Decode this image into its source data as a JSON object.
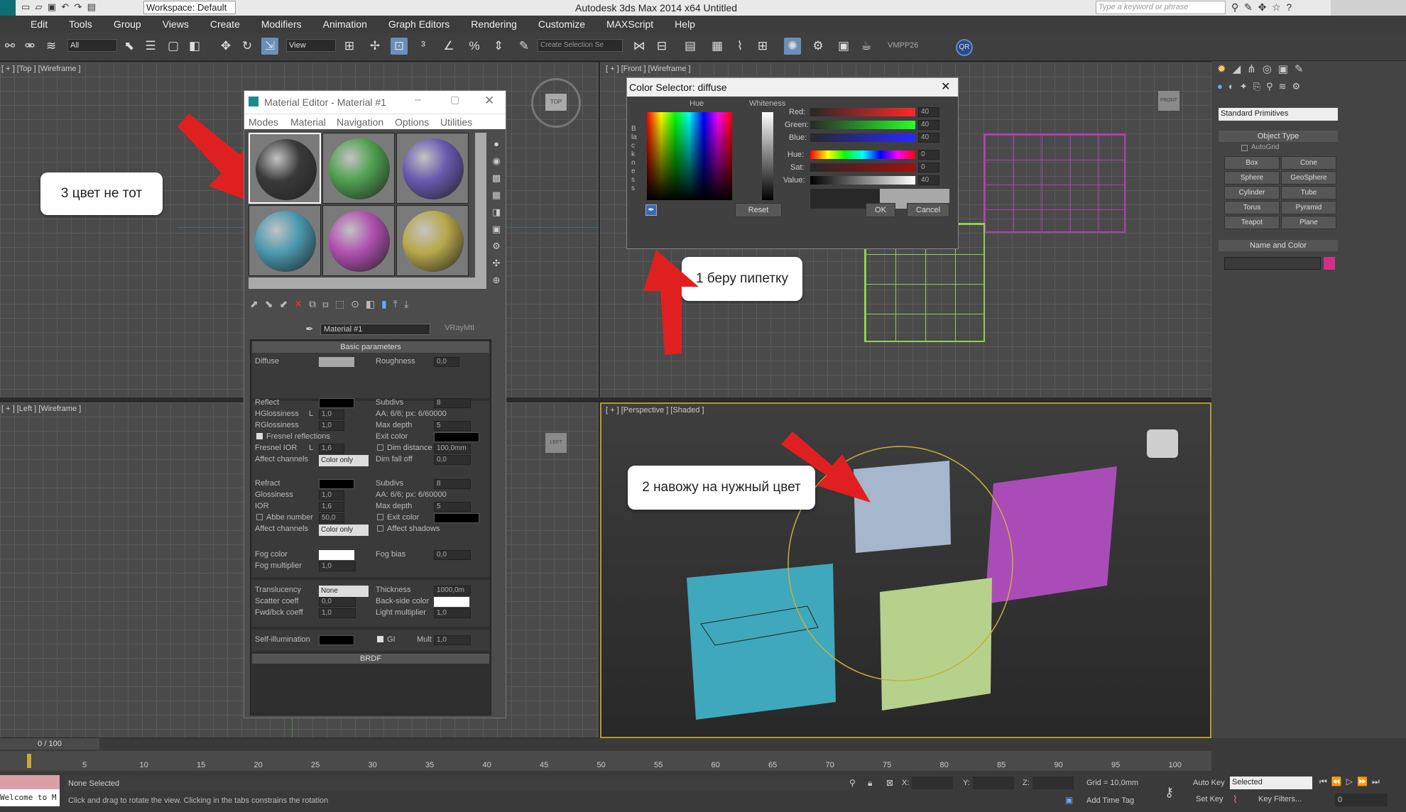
{
  "window": {
    "title": "Autodesk 3ds Max  2014 x64      Untitled",
    "workspace": "Workspace: Default",
    "search_placeholder": "Type a keyword or phrase"
  },
  "menu": [
    "Edit",
    "Tools",
    "Group",
    "Views",
    "Create",
    "Modifiers",
    "Animation",
    "Graph Editors",
    "Rendering",
    "Customize",
    "MAXScript",
    "Help"
  ],
  "toolbar": {
    "selection_filter": "All",
    "view": "View",
    "create_selection": "Create Selection Se",
    "vmpp": "VMPP26",
    "qr": "QR"
  },
  "viewports": {
    "top": "[ + ] [Top ] [Wireframe ]",
    "front": "[ + ] [Front ] [Wireframe ]",
    "left": "[ + ] [Left ] [Wireframe ]",
    "perspective": "[ + ] [Perspective ] [Shaded ]",
    "cube_top": "TOP",
    "cube_left": "LEFT",
    "cube_front": "FRONT"
  },
  "callouts": {
    "c1": "1 беру пипетку",
    "c2": "2 навожу на нужный цвет",
    "c3": "3 цвет не тот"
  },
  "material_editor": {
    "title": "Material Editor - Material #1",
    "menu": [
      "Modes",
      "Material",
      "Navigation",
      "Options",
      "Utilities"
    ],
    "material_name": "Material #1",
    "material_type": "VRayMtl",
    "section": "Basic parameters",
    "diffuse": "Diffuse",
    "roughness": "Roughness",
    "roughness_val": "0,0",
    "reflect": "Reflect",
    "subdivs": "Subdivs",
    "subdivs_val": "8",
    "hglossiness": "HGlossiness",
    "hgloss_lock": "L",
    "hgloss_val": "1,0",
    "aa": "AA: 6/6; px: 6/60000",
    "rglossiness": "RGlossiness",
    "rgloss_val": "1,0",
    "max_depth": "Max depth",
    "max_depth_val": "5",
    "fresnel": "Fresnel reflections",
    "exit_color": "Exit color",
    "fresnel_ior": "Fresnel IOR",
    "fresnel_lock": "L",
    "fresnel_ior_val": "1,6",
    "dim_distance": "Dim distance",
    "dim_distance_val": "100,0mm",
    "affect_channels": "Affect channels",
    "color_only": "Color only",
    "dim_falloff": "Dim fall off",
    "dim_falloff_val": "0,0",
    "refract": "Refract",
    "r_subdivs": "Subdivs",
    "r_subdivs_val": "8",
    "glossiness": "Glossiness",
    "glossiness_val": "1,0",
    "r_aa": "AA: 6/6; px: 6/60000",
    "ior": "IOR",
    "ior_val": "1,6",
    "r_max_depth": "Max depth",
    "r_max_depth_val": "5",
    "abbe": "Abbe number",
    "abbe_val": "50,0",
    "r_exit_color": "Exit color",
    "r_affect_channels": "Affect channels",
    "r_color_only": "Color only",
    "affect_shadows": "Affect shadows",
    "fog_color": "Fog color",
    "fog_bias": "Fog bias",
    "fog_bias_val": "0,0",
    "fog_multiplier": "Fog multiplier",
    "fog_multiplier_val": "1,0",
    "translucency": "Translucency",
    "translucency_val": "None",
    "thickness": "Thickness",
    "thickness_val": "1000,0m",
    "scatter_coeff": "Scatter coeff",
    "scatter_val": "0,0",
    "backside_color": "Back-side color",
    "fwd_bck": "Fwd/bck coeff",
    "fwd_val": "1,0",
    "light_multiplier": "Light multiplier",
    "light_mult_val": "1,0",
    "self_illum": "Self-illumination",
    "gi": "GI",
    "mult": "Mult",
    "mult_val": "1,0",
    "brdf": "BRDF",
    "spheres": [
      "#3a3a3a",
      "#4fa04f",
      "#6a5ab0",
      "#4a9ab0",
      "#b050b0",
      "#b8a84a"
    ]
  },
  "color_selector": {
    "title": "Color Selector: diffuse",
    "hue_label": "Hue",
    "whiteness_label": "Whiteness",
    "blackness_label": "Blackness",
    "red": "Red:",
    "green": "Green:",
    "blue": "Blue:",
    "hue": "Hue:",
    "sat": "Sat:",
    "value": "Value:",
    "red_val": "40",
    "green_val": "40",
    "blue_val": "40",
    "hue_val": "0",
    "sat_val": "0",
    "value_val": "40",
    "reset": "Reset",
    "ok": "OK",
    "cancel": "Cancel",
    "current_color": "#282828",
    "original_color": "#a8a8a8"
  },
  "command_panel": {
    "dropdown": "Standard Primitives",
    "object_type": "Object Type",
    "autogrid": "AutoGrid",
    "buttons": [
      "Box",
      "Cone",
      "Sphere",
      "GeoSphere",
      "Cylinder",
      "Tube",
      "Torus",
      "Pyramid",
      "Teapot",
      "Plane"
    ],
    "name_color": "Name and Color"
  },
  "timeline": {
    "frame": "0 / 100",
    "ticks": [
      "5",
      "10",
      "15",
      "20",
      "25",
      "30",
      "35",
      "40",
      "45",
      "50",
      "55",
      "60",
      "65",
      "70",
      "75",
      "80",
      "85",
      "90",
      "95",
      "100"
    ],
    "status": "None Selected",
    "prompt": "Click and drag to rotate the view.  Clicking in the tabs constrains the rotation",
    "script": "Welcome to M",
    "x": "X:",
    "y": "Y:",
    "z": "Z:",
    "grid": "Grid = 10,0mm",
    "add_time_tag": "Add Time Tag",
    "auto_key": "Auto Key",
    "selected": "Selected",
    "set_key": "Set Key",
    "key_filters": "Key Filters...",
    "frame_field": "0"
  }
}
